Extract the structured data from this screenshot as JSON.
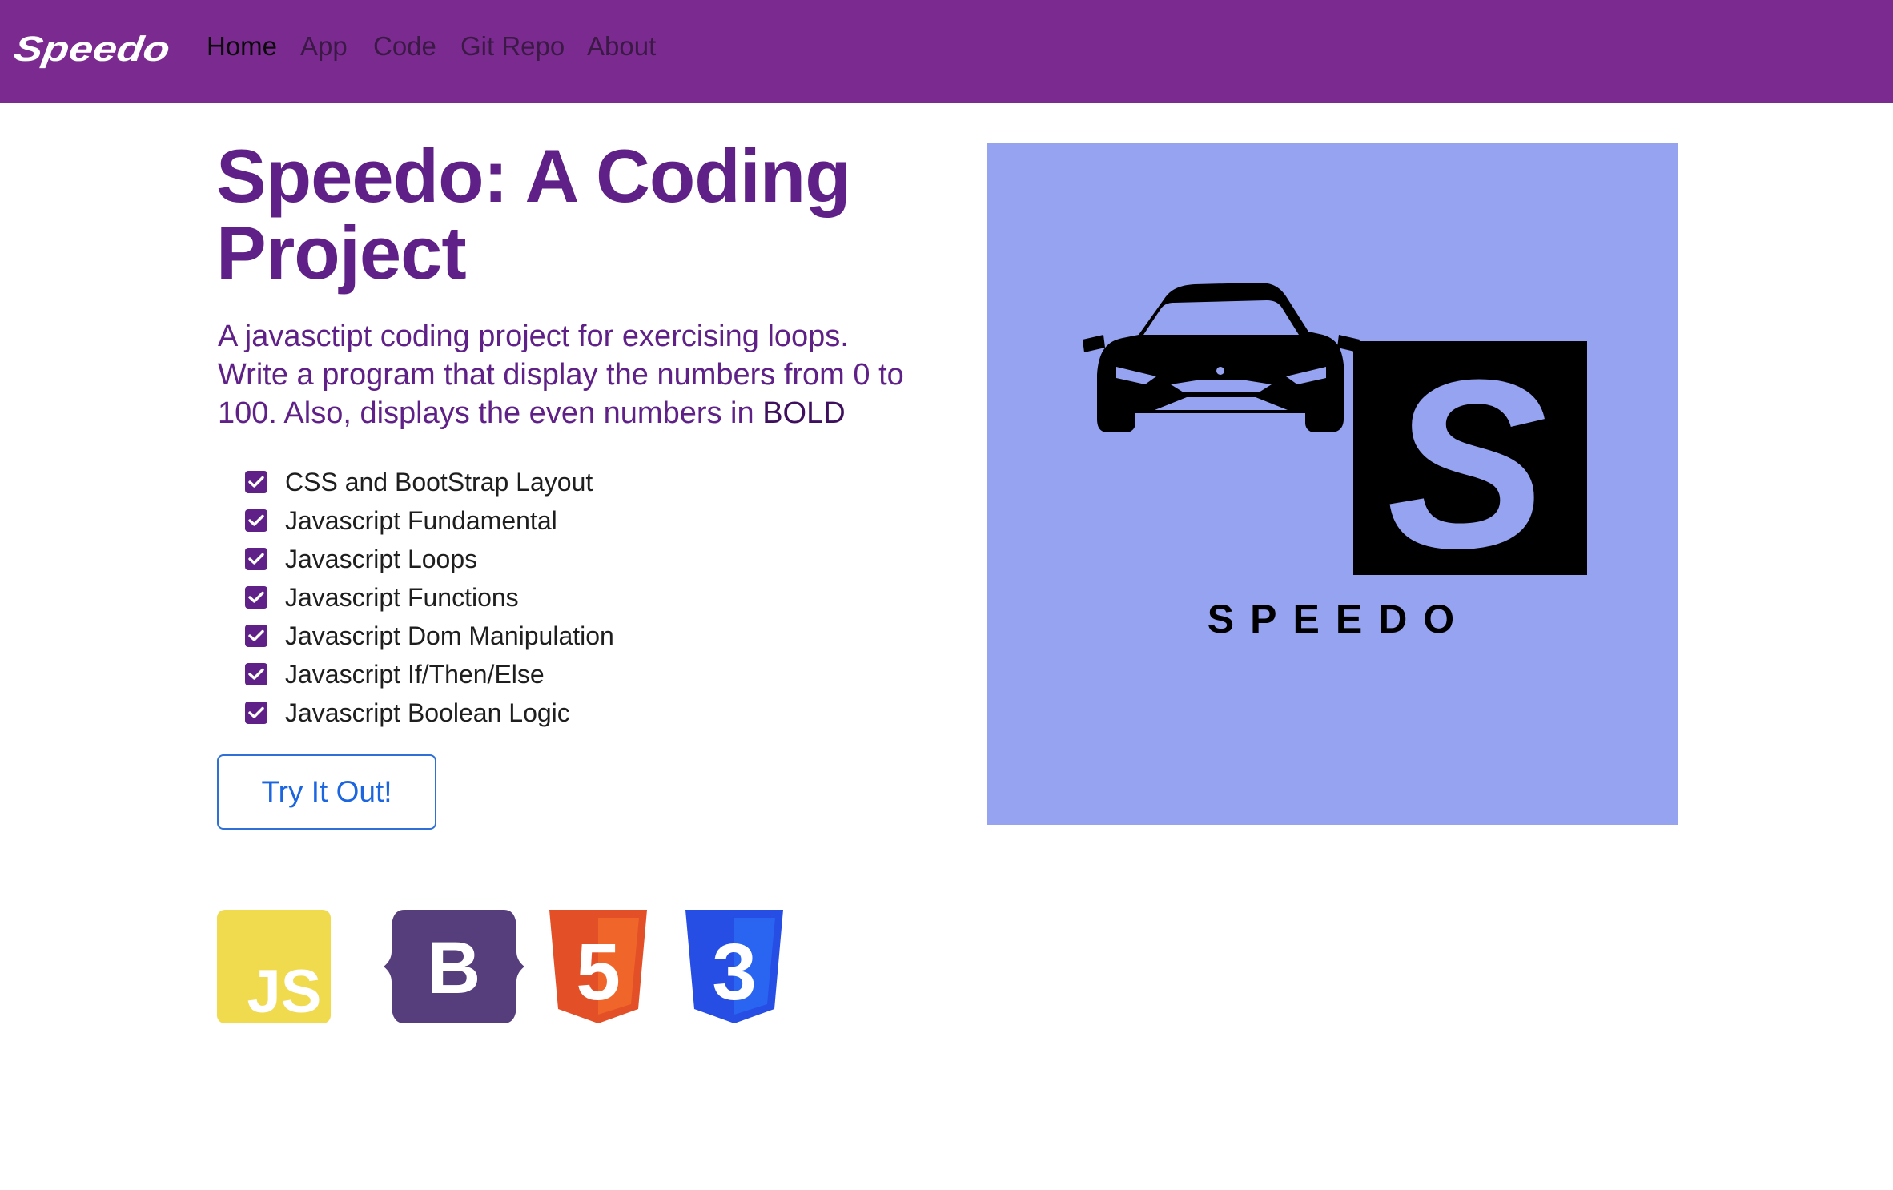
{
  "navbar": {
    "brand": "Speedo",
    "links": [
      "Home",
      "App",
      "Code",
      "Git Repo",
      "About"
    ],
    "active": "Home",
    "background": "#7b2a90"
  },
  "hero": {
    "title": "Speedo: A Coding Project",
    "lead": "A javasctipt coding project for exercising loops. Write a program that display the numbers from 0 to 100. Also, displays the even numbers in",
    "lead_bold": "BOLD",
    "checklist": [
      "CSS and BootStrap Layout",
      "Javascript Fundamental",
      "Javascript Loops",
      "Javascript Functions",
      "Javascript Dom Manipulation",
      "Javascript If/Then/Else",
      "Javascript Boolean Logic"
    ],
    "button": "Try It Out!",
    "accent": "#5f2187"
  },
  "logo_panel": {
    "wordmark": "SPEEDO",
    "monogram": "S",
    "background": "#96a3f0"
  },
  "tech_icons": [
    {
      "name": "javascript-icon",
      "text": "JS",
      "color": "#f0db4f"
    },
    {
      "name": "bootstrap-icon",
      "text": "B",
      "color": "#563d7c"
    },
    {
      "name": "html5-icon",
      "text": "5",
      "color": "#e34f26"
    },
    {
      "name": "css3-icon",
      "text": "3",
      "color": "#264de4"
    }
  ]
}
